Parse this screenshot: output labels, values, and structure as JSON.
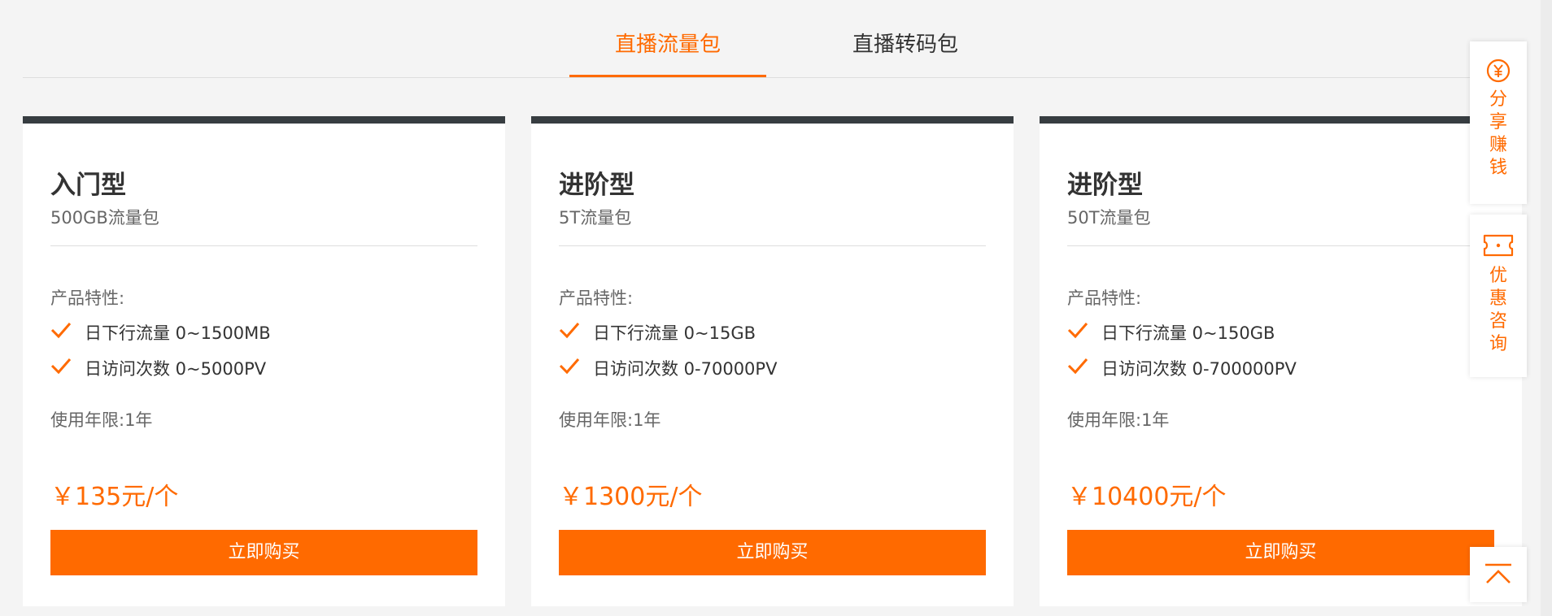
{
  "tabs": [
    {
      "label": "直播流量包",
      "active": true
    },
    {
      "label": "直播转码包",
      "active": false
    }
  ],
  "features_label": "产品特性:",
  "buy_label": "立即购买",
  "cards": [
    {
      "title": "入门型",
      "subtitle": "500GB流量包",
      "features": [
        "日下行流量 0~1500MB",
        "日访问次数 0~5000PV"
      ],
      "duration": "使用年限:1年",
      "price": "￥135元/个"
    },
    {
      "title": "进阶型",
      "subtitle": "5T流量包",
      "features": [
        "日下行流量 0~15GB",
        "日访问次数 0-70000PV"
      ],
      "duration": "使用年限:1年",
      "price": "￥1300元/个"
    },
    {
      "title": "进阶型",
      "subtitle": "50T流量包",
      "features": [
        "日下行流量 0~150GB",
        "日访问次数 0-700000PV"
      ],
      "duration": "使用年限:1年",
      "price": "￥10400元/个"
    }
  ],
  "floating": {
    "share_label": "分享赚钱",
    "consult_label": "优惠咨询",
    "share_icon": "yen-circle-icon",
    "consult_icon": "ticket-icon",
    "back_top_icon": "back-to-top-icon"
  },
  "colors": {
    "accent": "#ff6a00",
    "card_top_border": "#373d41",
    "background": "#f4f4f4"
  }
}
